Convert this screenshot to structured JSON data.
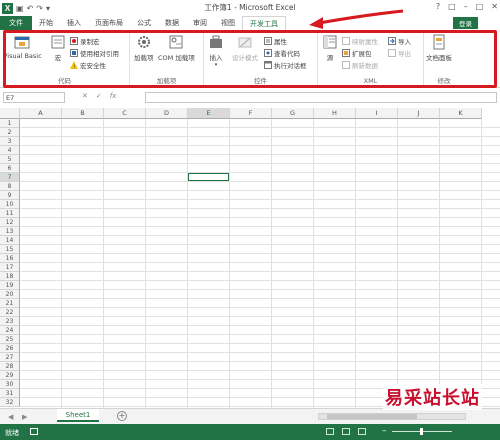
{
  "app": {
    "title": "工作簿1 - Microsoft Excel",
    "signin_label": "登录"
  },
  "quick_access": {
    "icons": [
      "save-icon",
      "undo-icon",
      "redo-icon"
    ]
  },
  "tabs": [
    {
      "label": "文件",
      "kind": "file"
    },
    {
      "label": "开始"
    },
    {
      "label": "插入"
    },
    {
      "label": "页面布局"
    },
    {
      "label": "公式"
    },
    {
      "label": "数据"
    },
    {
      "label": "审阅"
    },
    {
      "label": "视图"
    },
    {
      "label": "开发工具",
      "active": true
    }
  ],
  "ribbon": {
    "code": {
      "label": "代码",
      "visual_basic": "Visual Basic",
      "macros": "宏",
      "record_macro": "录制宏",
      "relative_refs": "使用相对引用",
      "macro_security": "宏安全性"
    },
    "addins": {
      "label": "加载项",
      "addins_btn": "加载项",
      "com_addins": "COM 加载项"
    },
    "controls": {
      "label": "控件",
      "insert": "插入",
      "design_mode": "设计模式",
      "properties": "属性",
      "view_code": "查看代码",
      "run_dialog": "执行对话框"
    },
    "xml": {
      "label": "XML",
      "source": "源",
      "map_properties": "映射属性",
      "expansion_packs": "扩展包",
      "refresh_data": "刷新数据",
      "import": "导入",
      "export": "导出"
    },
    "modify": {
      "label": "修改",
      "document_panel": "文档面板"
    }
  },
  "formula_bar": {
    "name_box": "E7",
    "fx": "fx",
    "formula": ""
  },
  "grid": {
    "columns": [
      "A",
      "B",
      "C",
      "D",
      "E",
      "F",
      "G",
      "H",
      "I",
      "J",
      "K"
    ],
    "rows": [
      "1",
      "2",
      "3",
      "4",
      "5",
      "6",
      "7",
      "8",
      "9",
      "10",
      "11",
      "12",
      "13",
      "14",
      "15",
      "16",
      "17",
      "18",
      "19",
      "20",
      "21",
      "22",
      "23",
      "24",
      "25",
      "26",
      "27",
      "28",
      "29",
      "30",
      "31",
      "32"
    ],
    "selected_column": "E",
    "selected_row": "7"
  },
  "sheets": [
    {
      "label": "Sheet1",
      "active": true
    }
  ],
  "status": {
    "text": "就绪"
  },
  "watermark": {
    "text": "易采站长站"
  },
  "colors": {
    "accent": "#217346",
    "highlight": "#d71920"
  }
}
